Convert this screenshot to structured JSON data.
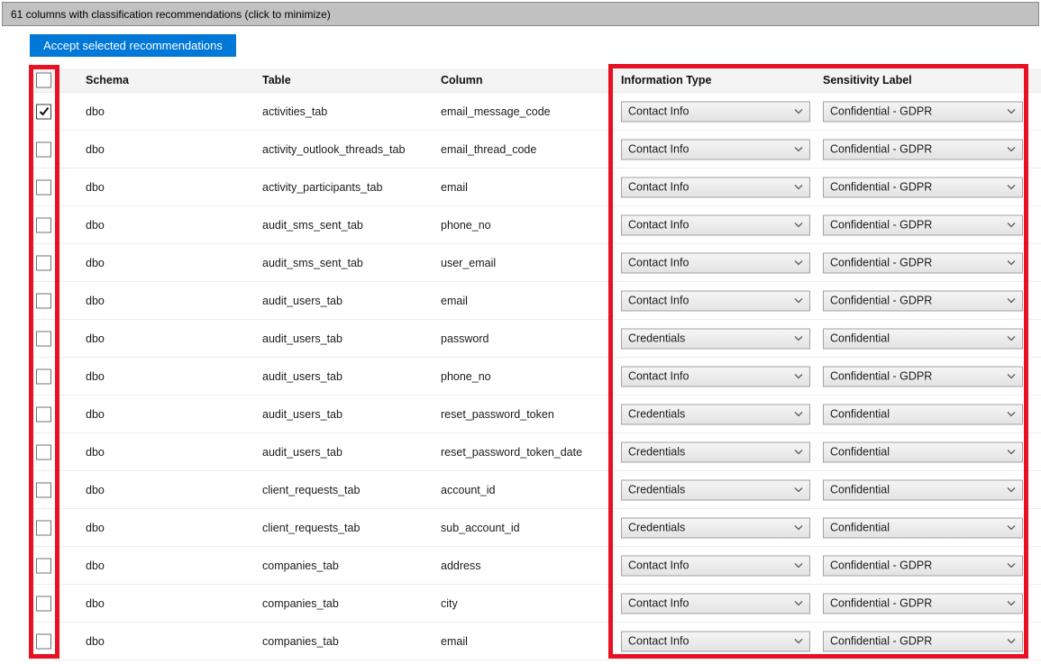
{
  "banner": {
    "text": "61 columns with classification recommendations (click to minimize)"
  },
  "toolbar": {
    "accept_button_label": "Accept selected recommendations"
  },
  "colors": {
    "accent_blue": "#0078d7",
    "annotation_red": "#e81123",
    "banner_gray": "#c1c1c1"
  },
  "table": {
    "headers": {
      "schema": "Schema",
      "table": "Table",
      "column": "Column",
      "information_type": "Information Type",
      "sensitivity_label": "Sensitivity Label"
    },
    "header_checkbox_checked": false,
    "rows": [
      {
        "checked": true,
        "schema": "dbo",
        "table": "activities_tab",
        "column": "email_message_code",
        "information_type": "Contact Info",
        "sensitivity_label": "Confidential - GDPR"
      },
      {
        "checked": false,
        "schema": "dbo",
        "table": "activity_outlook_threads_tab",
        "column": "email_thread_code",
        "information_type": "Contact Info",
        "sensitivity_label": "Confidential - GDPR"
      },
      {
        "checked": false,
        "schema": "dbo",
        "table": "activity_participants_tab",
        "column": "email",
        "information_type": "Contact Info",
        "sensitivity_label": "Confidential - GDPR"
      },
      {
        "checked": false,
        "schema": "dbo",
        "table": "audit_sms_sent_tab",
        "column": "phone_no",
        "information_type": "Contact Info",
        "sensitivity_label": "Confidential - GDPR"
      },
      {
        "checked": false,
        "schema": "dbo",
        "table": "audit_sms_sent_tab",
        "column": "user_email",
        "information_type": "Contact Info",
        "sensitivity_label": "Confidential - GDPR"
      },
      {
        "checked": false,
        "schema": "dbo",
        "table": "audit_users_tab",
        "column": "email",
        "information_type": "Contact Info",
        "sensitivity_label": "Confidential - GDPR"
      },
      {
        "checked": false,
        "schema": "dbo",
        "table": "audit_users_tab",
        "column": "password",
        "information_type": "Credentials",
        "sensitivity_label": "Confidential"
      },
      {
        "checked": false,
        "schema": "dbo",
        "table": "audit_users_tab",
        "column": "phone_no",
        "information_type": "Contact Info",
        "sensitivity_label": "Confidential - GDPR"
      },
      {
        "checked": false,
        "schema": "dbo",
        "table": "audit_users_tab",
        "column": "reset_password_token",
        "information_type": "Credentials",
        "sensitivity_label": "Confidential"
      },
      {
        "checked": false,
        "schema": "dbo",
        "table": "audit_users_tab",
        "column": "reset_password_token_date",
        "information_type": "Credentials",
        "sensitivity_label": "Confidential"
      },
      {
        "checked": false,
        "schema": "dbo",
        "table": "client_requests_tab",
        "column": "account_id",
        "information_type": "Credentials",
        "sensitivity_label": "Confidential"
      },
      {
        "checked": false,
        "schema": "dbo",
        "table": "client_requests_tab",
        "column": "sub_account_id",
        "information_type": "Credentials",
        "sensitivity_label": "Confidential"
      },
      {
        "checked": false,
        "schema": "dbo",
        "table": "companies_tab",
        "column": "address",
        "information_type": "Contact Info",
        "sensitivity_label": "Confidential - GDPR"
      },
      {
        "checked": false,
        "schema": "dbo",
        "table": "companies_tab",
        "column": "city",
        "information_type": "Contact Info",
        "sensitivity_label": "Confidential - GDPR"
      },
      {
        "checked": false,
        "schema": "dbo",
        "table": "companies_tab",
        "column": "email",
        "information_type": "Contact Info",
        "sensitivity_label": "Confidential - GDPR"
      }
    ]
  }
}
